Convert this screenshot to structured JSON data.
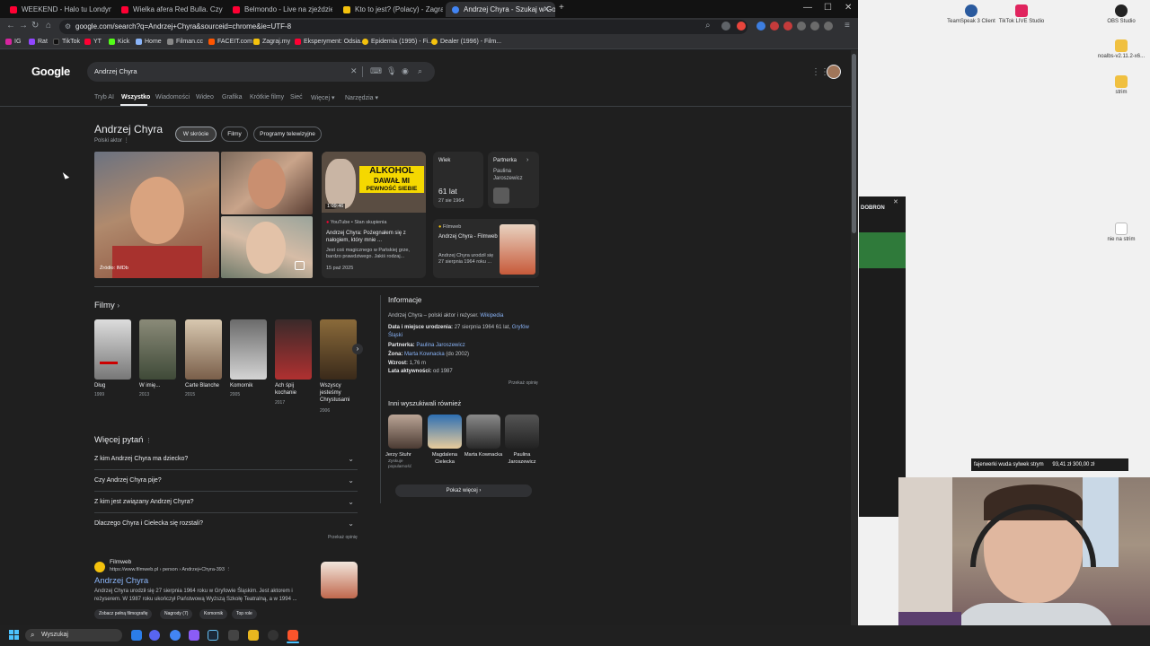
{
  "browser": {
    "tabs": [
      {
        "label": "WEEKEND - Halo tu Londyn (Oficjaln",
        "color": "#ff0033"
      },
      {
        "label": "Wielka afera Red Bulla. Czy ten napó",
        "color": "#ff0033"
      },
      {
        "label": "Belmondo - Live na zjeździe z chaty",
        "color": "#ff0033"
      },
      {
        "label": "Kto to jest? (Polacy) - Zagraj.my",
        "color": "#f4c20d"
      },
      {
        "label": "Andrzej Chyra - Szukaj w Google",
        "color": "#4285f4"
      }
    ],
    "new_tab": "+",
    "url": "google.com/search?q=Andrzej+Chyra&sourceid=chrome&ie=UTF-8",
    "bookmarks": [
      "IG",
      "Rat",
      "TikTok",
      "YT",
      "Kick",
      "Home",
      "Filman.cc",
      "FACEIT.com",
      "Zagraj.my",
      "Eksperyment: Odsia...",
      "Epidemia (1995) - Fi...",
      "Dealer (1996) - Film..."
    ]
  },
  "google": {
    "logo": "Google",
    "query": "Andrzej Chyra",
    "nav_tabs": [
      "Tryb AI",
      "Wszystko",
      "Wiadomości",
      "Wideo",
      "Grafika",
      "Krótkie filmy",
      "Sieć",
      "Więcej",
      "Narzędzia"
    ],
    "active_tab": "Wszystko",
    "kp": {
      "name": "Andrzej Chyra",
      "subtitle": "Polski aktor",
      "chips": [
        "W skrócie",
        "Filmy",
        "Programy telewizyjne"
      ],
      "photo_source": "Źródło: IMDb",
      "video_banner_1": "ALKOHOL",
      "video_banner_2": "DAWAŁ MI",
      "video_banner_3": "PEWNOŚĆ SIEBIE",
      "video_duration": "1:09:46",
      "video_source": "YouTube • Stan skupienia",
      "video_title": "Andrzej Chyra: Pożegnałem się z nałogiem, który mnie ...",
      "video_desc": "Jest coś magicznego w Pańskiej grze, bardzo prawdziwego. Jakiś rodzaj...",
      "video_date": "15 paź 2025",
      "age_label": "Wiek",
      "age_value": "61 lat",
      "age_date": "27 sie 1964",
      "partner_label": "Partnerka",
      "partner_name": "Paulina Jaroszewicz",
      "fw_source": "Filmweb",
      "fw_title": "Andrzej Chyra - Filmweb",
      "fw_desc": "Andrzej Chyra urodził się 27 sierpnia 1964 roku ..."
    },
    "films_title": "Filmy",
    "films": [
      {
        "title": "Dług",
        "year": "1999"
      },
      {
        "title": "W imię...",
        "year": "2013"
      },
      {
        "title": "Carte Blanche",
        "year": "2015"
      },
      {
        "title": "Komornik",
        "year": "2005"
      },
      {
        "title": "Ach śpij kochanie",
        "year": "2017"
      },
      {
        "title": "Wszyscy jesteśmy Chrystusami",
        "year": "2006"
      }
    ],
    "info": {
      "title": "Informacje",
      "desc_text": "Andrzej Chyra – polski aktor i reżyser.",
      "desc_link": "Wikipedia",
      "birth_label": "Data i miejsce urodzenia:",
      "birth_value": "27 sierpnia 1964",
      "birth_age": "61 lat,",
      "birth_place": "Gryfów Śląski",
      "partner_label": "Partnerka:",
      "partner_value": "Paulina Jaroszewicz",
      "spouse_label": "Żona:",
      "spouse_value": "Marta Kownacka",
      "spouse_note": "(do 2002)",
      "height_label": "Wzrost:",
      "height_value": "1,76 m",
      "active_label": "Lata aktywności:",
      "active_value": "od 1987",
      "feedback": "Przekaż opinię"
    },
    "also_title": "Inni wyszukiwali również",
    "also": [
      {
        "name": "Jerzy Stuhr",
        "note": "Zyskuje popularność"
      },
      {
        "name": "Magdalena Cielecka",
        "note": ""
      },
      {
        "name": "Marta Kownacka",
        "note": ""
      },
      {
        "name": "Paulina Jaroszewicz",
        "note": ""
      }
    ],
    "show_more": "Pokaż więcej",
    "paa_title": "Więcej pytań",
    "paa": [
      "Z kim Andrzej Chyra ma dziecko?",
      "Czy Andrzej Chyra pije?",
      "Z kim jest związany Andrzej Chyra?",
      "Dlaczego Chyra i Cielecka się rozstali?"
    ],
    "paa_feedback": "Przekaż opinię",
    "result": {
      "site": "Filmweb",
      "url": "https://www.filmweb.pl › person › Andrzej+Chyra-393",
      "title": "Andrzej Chyra",
      "snippet": "Andrzej Chyra urodził się 27 sierpnia 1964 roku w Gryfowie Śląskim. Jest aktorem i reżyserem. W 1987 roku ukończył Państwową Wyższą Szkołę Teatralną, a w 1994 ...",
      "sitelinks": [
        "Zobacz pełną filmografię",
        "Nagrody (7)",
        "Komornik",
        "Top role"
      ]
    }
  },
  "desktop": {
    "icons": [
      "TeamSpeak 3 Client",
      "TikTok LIVE Studio",
      "OBS Studio",
      "noalbs-v2.11.2-x6...",
      "strim",
      "nie na strim"
    ],
    "donation": "fajerwerki wuda sylwek strym",
    "donation_amounts": "93,41 zł  300,00 zł",
    "obs_text": "DOBRON"
  },
  "taskbar": {
    "search": "Wyszukaj"
  }
}
